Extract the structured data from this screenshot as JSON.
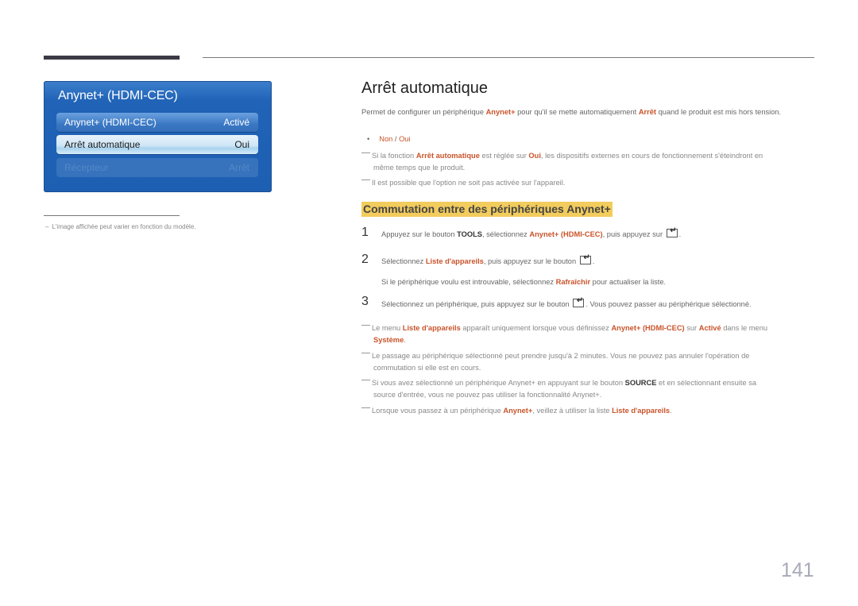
{
  "osd": {
    "title": "Anynet+ (HDMI-CEC)",
    "items": [
      {
        "label": "Anynet+ (HDMI-CEC)",
        "value": "Activé",
        "state": "normal"
      },
      {
        "label": "Arrêt automatique",
        "value": "Oui",
        "state": "selected"
      },
      {
        "label": "Récepteur",
        "value": "Arrêt",
        "state": "disabled"
      }
    ]
  },
  "footnote": "L'image affichée peut varier en fonction du modèle.",
  "section1": {
    "title": "Arrêt automatique",
    "desc": {
      "a": "Permet de configurer un périphérique ",
      "b": "Anynet+",
      "c": " pour qu'il se mette automatiquement ",
      "d": "Arrêt",
      "e": " quand le produit est mis hors tension."
    },
    "options": {
      "non": "Non",
      "sep": " / ",
      "oui": "Oui"
    },
    "note1": {
      "a": "Si la fonction ",
      "b": "Arrêt automatique",
      "c": " est réglée sur ",
      "d": "Oui",
      "e": ", les dispositifs externes en cours de fonctionnement s'éteindront en",
      "f": "même temps que le produit."
    },
    "note2": "Il est possible que l'option ne soit pas activée sur l'appareil."
  },
  "section2": {
    "title": "Commutation entre des périphériques Anynet+",
    "steps": [
      {
        "num": "1",
        "a": "Appuyez sur le bouton ",
        "b": "TOOLS",
        "c": ", sélectionnez ",
        "d": "Anynet+ (HDMI-CEC)",
        "e": ", puis appuyez sur ",
        "f": "."
      },
      {
        "num": "2",
        "a": "Sélectionnez ",
        "b": "Liste d'appareils",
        "c": ", puis appuyez sur le bouton ",
        "d": "."
      },
      {
        "num": "3",
        "a": "Sélectionnez un périphérique, puis appuyez sur le bouton ",
        "b": ". Vous pouvez passer au périphérique sélectionné."
      }
    ],
    "step2_sub": {
      "a": "Si le périphérique voulu est introuvable, sélectionnez ",
      "b": "Rafraîchir",
      "c": " pour actualiser la liste."
    },
    "notes": {
      "n1": {
        "a": "Le menu ",
        "b": "Liste d'appareils",
        "c": " apparaît uniquement lorsque vous définissez ",
        "d": "Anynet+ (HDMI-CEC)",
        "e": " sur ",
        "f": "Activé",
        "g": " dans le menu",
        "h": "Système",
        "i": "."
      },
      "n2": {
        "a": "Le passage au périphérique sélectionné peut prendre jusqu'à 2 minutes. Vous ne pouvez pas annuler l'opération de",
        "b": "commutation si elle est en cours."
      },
      "n3": {
        "a": "Si vous avez sélectionné un périphérique Anynet+ en appuyant sur le bouton ",
        "b": "SOURCE",
        "c": " et en sélectionnant ensuite sa",
        "d": "source d'entrée, vous ne pouvez pas utiliser la fonctionnalité Anynet+."
      },
      "n4": {
        "a": "Lorsque vous passez à un périphérique ",
        "b": "Anynet+",
        "c": ", veillez à utiliser la liste ",
        "d": "Liste d'appareils",
        "e": "."
      }
    }
  },
  "page_number": "141",
  "colors": {
    "highlight": "#c9532a",
    "heading_bg": "#f2cc5c",
    "osd_blue": "#1d5fb2"
  }
}
